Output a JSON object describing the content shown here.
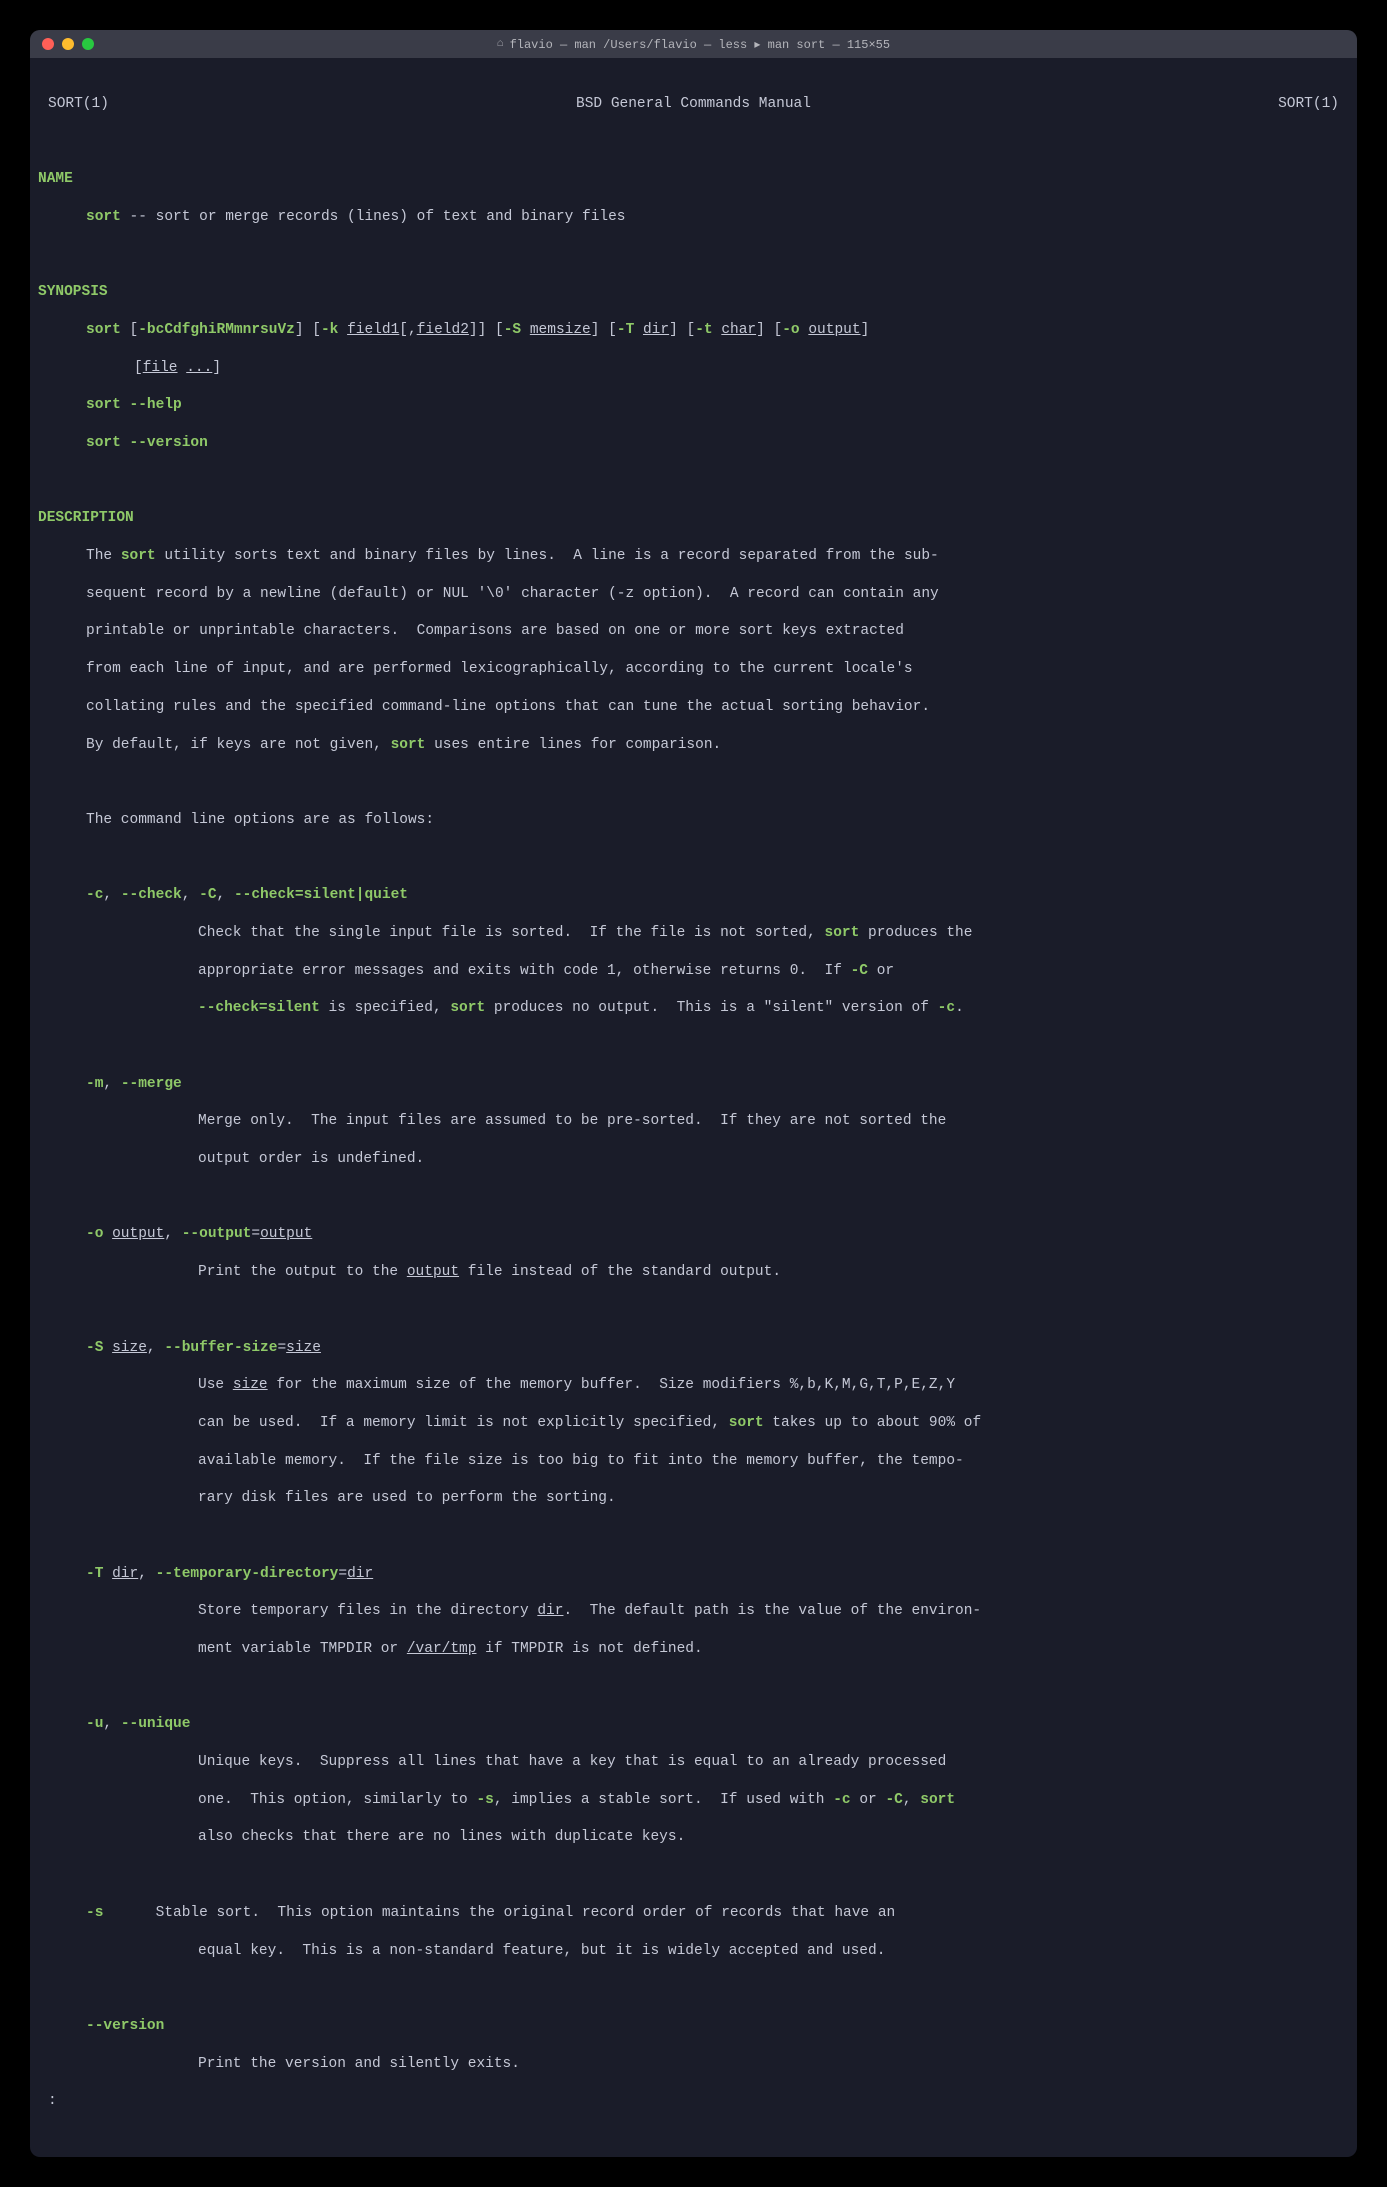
{
  "window": {
    "title": "flavio — man /Users/flavio — less ▸ man sort — 115×55"
  },
  "header": {
    "left": "SORT(1)",
    "center": "BSD General Commands Manual",
    "right": "SORT(1)"
  },
  "sections": {
    "name": {
      "heading": "NAME",
      "cmd": "sort",
      "desc": " -- sort or merge records (lines) of text and binary files"
    },
    "synopsis": {
      "heading": "SYNOPSIS",
      "line1": {
        "cmd": "sort",
        "b1": " [",
        "flags": "-bcCdfghiRMmnrsuVz",
        "b2": "] [",
        "k": "-k",
        "sp1": " ",
        "field1": "field1",
        "b3": "[,",
        "field2": "field2",
        "b4": "]] [",
        "S": "-S",
        "sp2": " ",
        "memsize": "memsize",
        "b5": "] [",
        "T": "-T",
        "sp3": " ",
        "dir": "dir",
        "b6": "] [",
        "t": "-t",
        "sp4": " ",
        "char": "char",
        "b7": "] [",
        "o": "-o",
        "sp5": " ",
        "output": "output",
        "b8": "]"
      },
      "line2": {
        "b1": "[",
        "file": "file",
        "sp": " ",
        "dots": "...",
        "b2": "]"
      },
      "line3": {
        "cmd": "sort",
        "flag": " --help"
      },
      "line4": {
        "cmd": "sort",
        "flag": " --version"
      }
    },
    "description": {
      "heading": "DESCRIPTION",
      "para1": {
        "p1": "The ",
        "sort1": "sort",
        "p2": " utility sorts text and binary files by lines.  A line is a record separated from the sub-",
        "p3": "sequent record by a newline (default) or NUL '\\0' character (-z option).  A record can contain any",
        "p4": "printable or unprintable characters.  Comparisons are based on one or more sort keys extracted",
        "p5": "from each line of input, and are performed lexicographically, according to the current locale's",
        "p6": "collating rules and the specified command-line options that can tune the actual sorting behavior.",
        "p7": "By default, if keys are not given, ",
        "sort2": "sort",
        "p8": " uses entire lines for comparison."
      },
      "para2": "The command line options are as follows:",
      "opt_c": {
        "f1": "-c",
        "c1": ", ",
        "f2": "--check",
        "c2": ", ",
        "f3": "-C",
        "c3": ", ",
        "f4": "--check=silent|quiet",
        "d1": "Check that the single input file is sorted.  If the file is not sorted, ",
        "sort1": "sort",
        "d2": " produces the",
        "d3": "appropriate error messages and exits with code 1, otherwise returns 0.  If ",
        "C": "-C",
        "d4": " or",
        "f5": "--check=silent",
        "d5": " is specified, ",
        "sort2": "sort",
        "d6": " produces no output.  This is a \"silent\" version of ",
        "c_flag": "-c",
        "d7": "."
      },
      "opt_m": {
        "f1": "-m",
        "c1": ", ",
        "f2": "--merge",
        "d1": "Merge only.  The input files are assumed to be pre-sorted.  If they are not sorted the",
        "d2": "output order is undefined."
      },
      "opt_o": {
        "f1": "-o",
        "sp": " ",
        "u1": "output",
        "c1": ", ",
        "f2": "--output",
        "eq": "=",
        "u2": "output",
        "d1": "Print the output to the ",
        "u3": "output",
        "d2": " file instead of the standard output."
      },
      "opt_S": {
        "f1": "-S",
        "sp": " ",
        "u1": "size",
        "c1": ", ",
        "f2": "--buffer-size",
        "eq": "=",
        "u2": "size",
        "d1": "Use ",
        "u3": "size",
        "d2": " for the maximum size of the memory buffer.  Size modifiers %,b,K,M,G,T,P,E,Z,Y",
        "d3": "can be used.  If a memory limit is not explicitly specified, ",
        "sort": "sort",
        "d4": " takes up to about 90% of",
        "d5": "available memory.  If the file size is too big to fit into the memory buffer, the tempo-",
        "d6": "rary disk files are used to perform the sorting."
      },
      "opt_T": {
        "f1": "-T",
        "sp": " ",
        "u1": "dir",
        "c1": ", ",
        "f2": "--temporary-directory",
        "eq": "=",
        "u2": "dir",
        "d1": "Store temporary files in the directory ",
        "u3": "dir",
        "d2": ".  The default path is the value of the environ-",
        "d3": "ment variable TMPDIR or ",
        "u4": "/var/tmp",
        "d4": " if TMPDIR is not defined."
      },
      "opt_u": {
        "f1": "-u",
        "c1": ", ",
        "f2": "--unique",
        "d1": "Unique keys.  Suppress all lines that have a key that is equal to an already processed",
        "d2": "one.  This option, similarly to ",
        "s": "-s",
        "d3": ", implies a stable sort.  If used with ",
        "c_flag": "-c",
        "d4": " or ",
        "C_flag": "-C",
        "d5": ", ",
        "sort": "sort",
        "d6": "also checks that there are no lines with duplicate keys."
      },
      "opt_s": {
        "f1": "-s",
        "d1": "      Stable sort.  This option maintains the original record order of records that have an",
        "d2": "equal key.  This is a non-standard feature, but it is widely accepted and used."
      },
      "opt_version": {
        "f1": "--version",
        "d1": "Print the version and silently exits."
      }
    },
    "prompt": ":"
  }
}
